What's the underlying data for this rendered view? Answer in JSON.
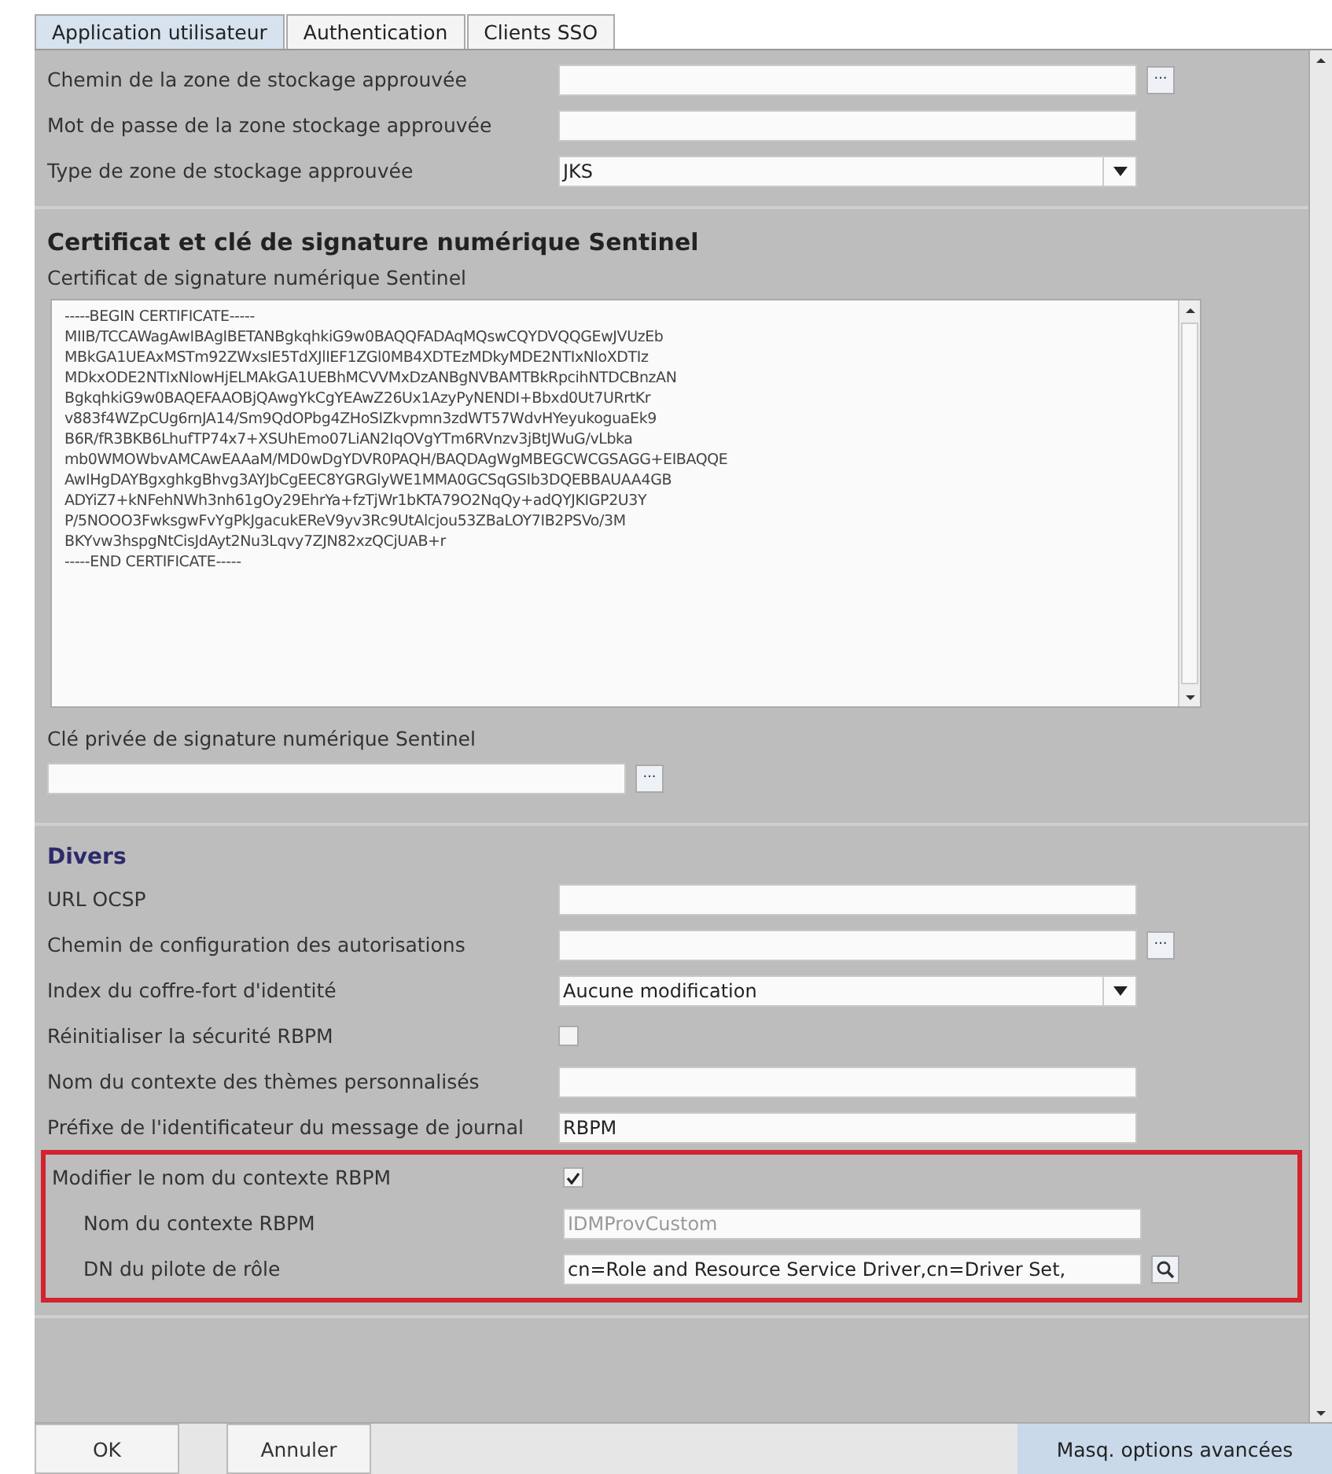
{
  "tabs": [
    {
      "label": "Application utilisateur",
      "selected": true
    },
    {
      "label": "Authentication",
      "selected": false
    },
    {
      "label": "Clients SSO",
      "selected": false
    }
  ],
  "sections": [
    {
      "rows": [
        {
          "kind": "browse",
          "label": "Chemin de la zone de stockage approuvée",
          "value": "",
          "button": "..."
        },
        {
          "kind": "text",
          "label": "Mot de passe de la zone stockage approuvée",
          "value": ""
        },
        {
          "kind": "select",
          "label": "Type de zone de stockage approuvée",
          "value": "JKS"
        }
      ]
    },
    {
      "title": "Certificat et clé de signature numérique Sentinel",
      "rows": [
        {
          "kind": "textarea",
          "label": "Certificat de signature numérique Sentinel",
          "value": "-----BEGIN CERTIFICATE-----\nMIIB/TCCAWagAwIBAgIBETANBgkqhkiG9w0BAQQFADAqMQswCQYDVQQGEwJVUzEb\nMBkGA1UEAxMSTm92ZWxsIE5TdXJlIEF1ZGl0MB4XDTEzMDkyMDE2NTIxNloXDTIz\nMDkxODE2NTIxNlowHjELMAkGA1UEBhMCVVMxDzANBgNVBAMTBkRpcihNTDCBnzAN\nBgkqhkiG9w0BAQEFAAOBjQAwgYkCgYEAwZ26Ux1AzyPyNENDI+Bbxd0Ut7URrtKr\nv883f4WZpCUg6rnJA14/Sm9QdOPbg4ZHoSIZkvpmn3zdWT57WdvHYeyukoguaEk9\nB6R/fR3BKB6LhufTP74x7+XSUhEmo07LiAN2IqOVgYTm6RVnzv3jBtJWuG/vLbka\nmb0WMOWbvAMCAwEAAaM/MD0wDgYDVR0PAQH/BAQDAgWgMBEGCWCGSAGG+EIBAQQE\nAwIHgDAYBgxghkgBhvg3AYJbCgEEC8YGRGlyWE1MMA0GCSqGSIb3DQEBBAUAA4GB\nADYiZ7+kNFehNWh3nh61gOy29EhrYa+fzTjWr1bKTA79O2NqQy+adQYJKIGP2U3Y\nP/5NOOO3FwksgwFvYgPkJgacukEReV9yv3Rc9UtAlcjou53ZBaLOY7IB2PSVo/3M\nBKYvw3hspgNtCisJdAyt2Nu3Lqvy7ZJN82xzQCjUAB+r\n-----END CERTIFICATE-----"
        },
        {
          "kind": "stacked-browse",
          "label": "Clé privée de signature numérique Sentinel",
          "value": "",
          "button": "..."
        }
      ]
    },
    {
      "title": "Divers",
      "rows": [
        {
          "kind": "text",
          "label": "URL OCSP",
          "value": ""
        },
        {
          "kind": "browse",
          "label": "Chemin de configuration des autorisations",
          "value": "",
          "button": "..."
        },
        {
          "kind": "select",
          "label": "Index du coffre-fort d'identité",
          "value": "Aucune modification"
        },
        {
          "kind": "checkbox",
          "label": "Réinitialiser la sécurité RBPM",
          "checked": false
        },
        {
          "kind": "text",
          "label": "Nom du contexte des thèmes personnalisés",
          "value": ""
        },
        {
          "kind": "text",
          "label": "Préfixe de l'identificateur du message de journal",
          "value": "RBPM"
        },
        {
          "kind": "checkbox",
          "label": "Modifier le nom du contexte RBPM",
          "checked": true,
          "highlighted": true,
          "children": [
            {
              "kind": "text",
              "label": "Nom du contexte RBPM",
              "value": "IDMProvCustom",
              "disabled": true
            },
            {
              "kind": "lookup",
              "label": "DN du pilote de rôle",
              "value": "cn=Role and Resource Service Driver,cn=Driver Set,",
              "disabled": false
            }
          ]
        }
      ]
    }
  ],
  "buttons": [
    {
      "label": "OK"
    },
    {
      "label": "Annuler"
    }
  ],
  "advanced_toggle": "Masq. options avancées"
}
